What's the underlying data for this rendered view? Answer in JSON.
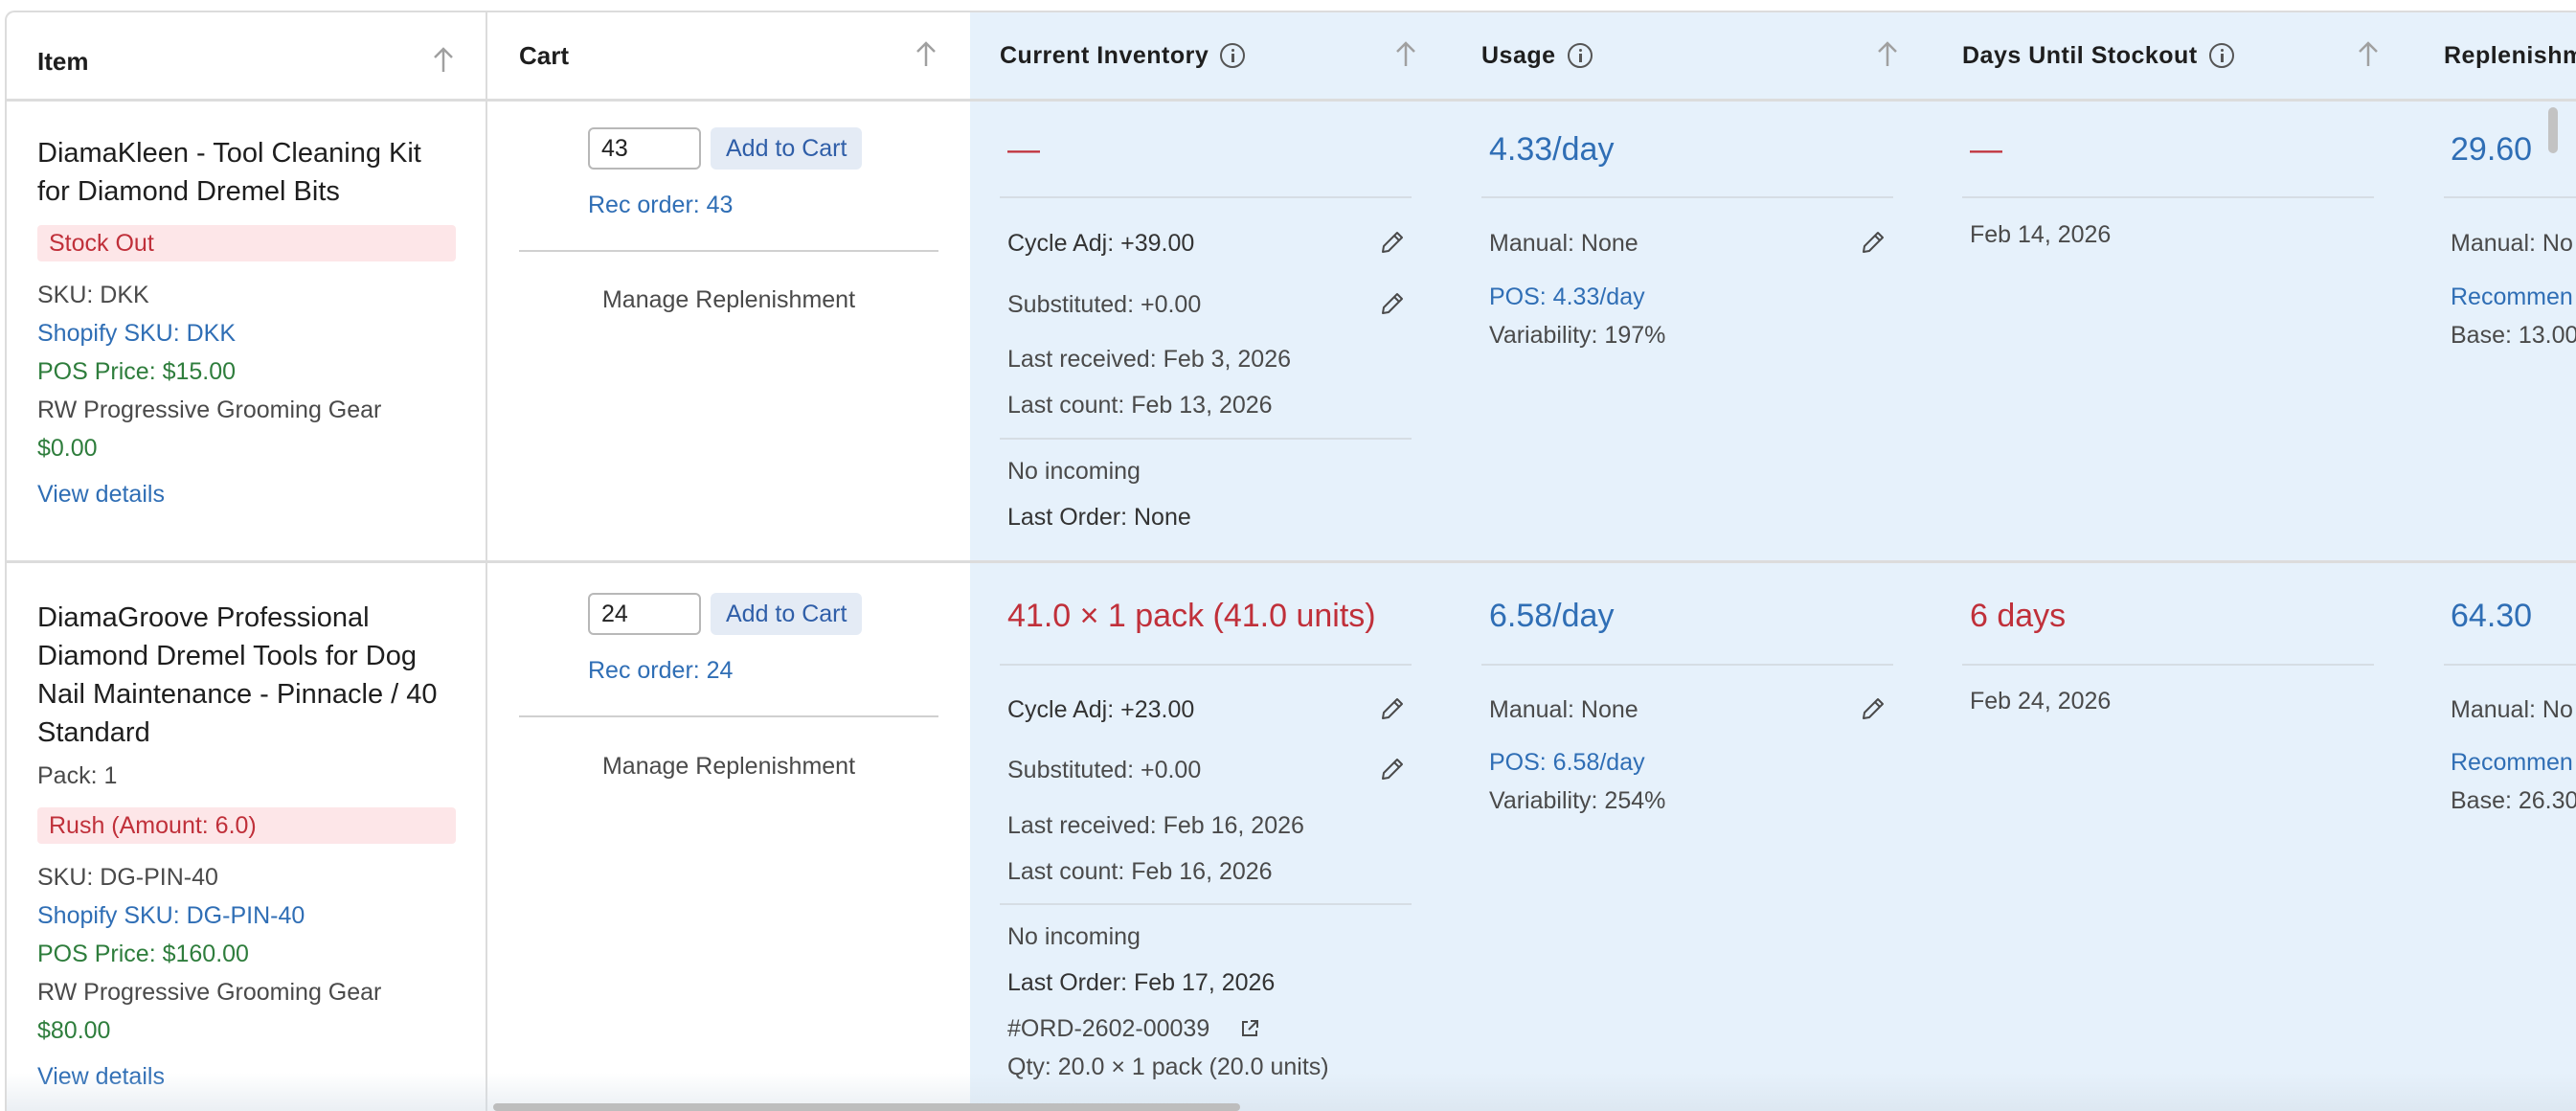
{
  "columns": {
    "item": "Item",
    "cart": "Cart",
    "inventory": "Current Inventory",
    "usage": "Usage",
    "days": "Days Until Stockout",
    "replenishment": "Replenishm"
  },
  "rows": [
    {
      "title": "DiamaKleen - Tool Cleaning Kit for Diamond Dremel Bits",
      "pack": "",
      "badge": "Stock Out",
      "sku": "SKU: DKK",
      "shopify_sku": "Shopify SKU: DKK",
      "pos_price": "POS Price: $15.00",
      "vendor": "RW Progressive Grooming Gear",
      "cost": "$0.00",
      "view_details": "View details",
      "cart_qty": "43",
      "add_to_cart": "Add to Cart",
      "rec_order": "Rec order: 43",
      "manage": "Manage Replenishment",
      "inventory_main": "—",
      "cycle_adj": "Cycle Adj: +39.00",
      "substituted": "Substituted: +0.00",
      "last_received": "Last received: Feb 3, 2026",
      "last_count": "Last count: Feb 13, 2026",
      "incoming": "No incoming",
      "last_order": "Last Order: None",
      "order_id": "",
      "order_qty": "",
      "usage_main": "4.33/day",
      "manual": "Manual: None",
      "pos_usage": "POS: 4.33/day",
      "variability": "Variability: 197%",
      "days_main": "—",
      "stockout_date": "Feb 14, 2026",
      "repl_main": "29.60",
      "repl_manual": "Manual: No",
      "repl_rec": "Recommen",
      "repl_base": "Base: 13.00"
    },
    {
      "title": "DiamaGroove Professional Diamond Dremel Tools for Dog Nail Maintenance - Pinnacle / 40 Standard",
      "pack": "Pack: 1",
      "badge": "Rush (Amount: 6.0)",
      "sku": "SKU: DG-PIN-40",
      "shopify_sku": "Shopify SKU: DG-PIN-40",
      "pos_price": "POS Price: $160.00",
      "vendor": "RW Progressive Grooming Gear",
      "cost": "$80.00",
      "view_details": "View details",
      "cart_qty": "24",
      "add_to_cart": "Add to Cart",
      "rec_order": "Rec order: 24",
      "manage": "Manage Replenishment",
      "inventory_main": "41.0 × 1 pack (41.0 units)",
      "cycle_adj": "Cycle Adj: +23.00",
      "substituted": "Substituted: +0.00",
      "last_received": "Last received: Feb 16, 2026",
      "last_count": "Last count: Feb 16, 2026",
      "incoming": "No incoming",
      "last_order": "Last Order: Feb 17, 2026",
      "order_id": "#ORD-2602-00039",
      "order_qty": "Qty: 20.0 × 1 pack (20.0 units)",
      "usage_main": "6.58/day",
      "manual": "Manual: None",
      "pos_usage": "POS: 6.58/day",
      "variability": "Variability: 254%",
      "days_main": "6 days",
      "stockout_date": "Feb 24, 2026",
      "repl_main": "64.30",
      "repl_manual": "Manual: No",
      "repl_rec": "Recommen",
      "repl_base": "Base: 26.30"
    }
  ],
  "icons": [
    "sort-arrow-icon",
    "info-icon",
    "pencil-icon",
    "external-link-icon"
  ],
  "colors": {
    "highlight_bg": "#e6f1fb",
    "link_blue": "#2f6eb5",
    "price_green": "#2e7d3c",
    "alert_red": "#c0303a",
    "badge_bg": "#fde6e8"
  }
}
